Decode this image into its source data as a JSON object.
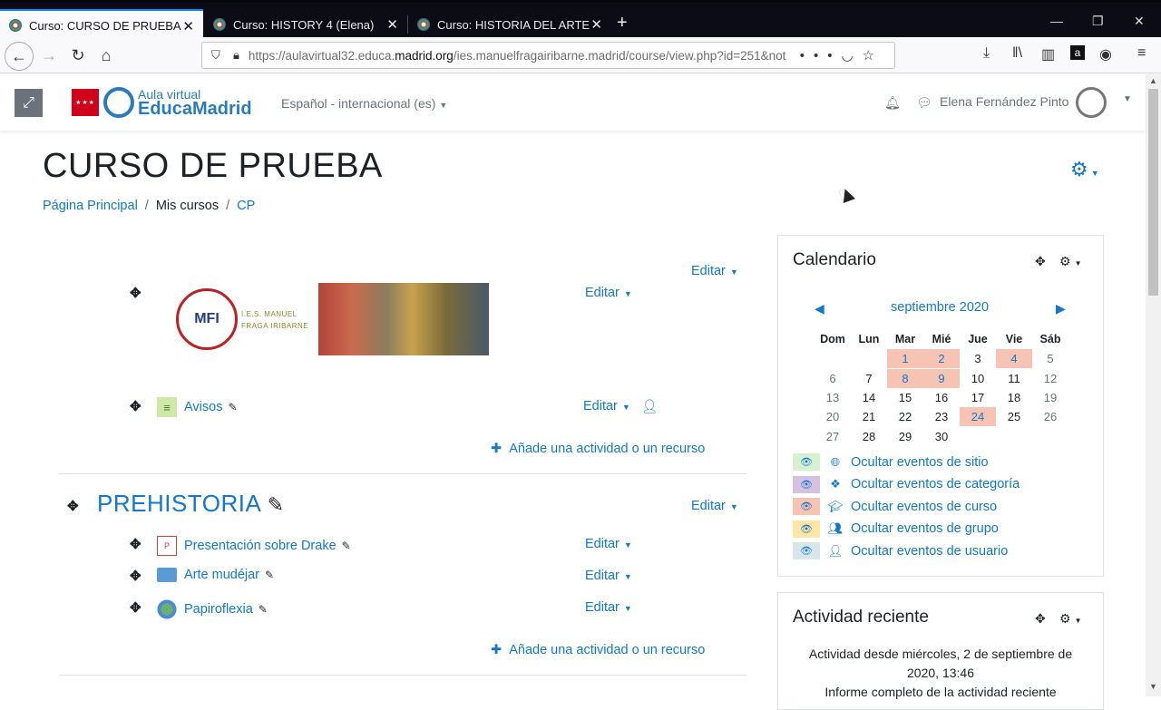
{
  "browser": {
    "tabs": [
      {
        "title": "Curso: CURSO DE PRUEBA",
        "active": true
      },
      {
        "title": "Curso: HISTORY 4 (Elena)",
        "active": false
      },
      {
        "title": "Curso: HISTORIA DEL ARTE",
        "active": false
      }
    ],
    "url_prefix": "https://aulavirtual32.educa.",
    "url_domain": "madrid.org",
    "url_suffix": "/ies.manuelfragairibarne.madrid/course/view.php?id=251&not"
  },
  "header": {
    "logo_line1": "Aula virtual",
    "logo_line2": "EducaMadrid",
    "language": "Español - internacional (es)",
    "user_name": "Elena Fernández Pinto"
  },
  "page": {
    "title": "CURSO DE PRUEBA",
    "breadcrumb": [
      "Página Principal",
      "Mis cursos",
      "CP"
    ]
  },
  "course": {
    "edit_label": "Editar",
    "add_label": "Añade una actividad o un recurso",
    "top_activities": [
      {
        "name": "Avisos",
        "icon": "forum-icon"
      }
    ],
    "section_title": "PREHISTORIA",
    "section_activities": [
      {
        "name": "Presentación sobre Drake",
        "icon": "powerpoint-icon"
      },
      {
        "name": "Arte mudéjar",
        "icon": "folder-icon"
      },
      {
        "name": "Papiroflexia",
        "icon": "url-icon"
      }
    ],
    "logo_text": "MFI",
    "logo_school": "I.E.S. MANUEL FRAGA IRIBARNE"
  },
  "calendar": {
    "title": "Calendario",
    "month": "septiembre 2020",
    "days": [
      "Dom",
      "Lun",
      "Mar",
      "Mié",
      "Jue",
      "Vie",
      "Sáb"
    ],
    "weeks": [
      [
        "",
        "",
        "1",
        "2",
        "3",
        "4",
        "5"
      ],
      [
        "6",
        "7",
        "8",
        "9",
        "10",
        "11",
        "12"
      ],
      [
        "13",
        "14",
        "15",
        "16",
        "17",
        "18",
        "19"
      ],
      [
        "20",
        "21",
        "22",
        "23",
        "24",
        "25",
        "26"
      ],
      [
        "27",
        "28",
        "29",
        "30",
        "",
        "",
        ""
      ]
    ],
    "event_days": [
      "1",
      "2",
      "4",
      "8",
      "9",
      "24"
    ],
    "filters": [
      {
        "label": "Ocultar eventos de sitio",
        "color": "#d7f0d0",
        "icon": "globe-icon"
      },
      {
        "label": "Ocultar eventos de categoría",
        "color": "#d6c2e0",
        "icon": "cubes-icon"
      },
      {
        "label": "Ocultar eventos de curso",
        "color": "#f7c4b3",
        "icon": "graduation-cap-icon"
      },
      {
        "label": "Ocultar eventos de grupo",
        "color": "#fde6a6",
        "icon": "users-icon"
      },
      {
        "label": "Ocultar eventos de usuario",
        "color": "#d8e6ea",
        "icon": "user-icon"
      }
    ]
  },
  "recent": {
    "title": "Actividad reciente",
    "since": "Actividad desde miércoles, 2 de septiembre de 2020, 13:46",
    "report": "Informe completo de la actividad reciente"
  },
  "colors": {
    "link": "#1177d1",
    "tabbar": "#0c0c17"
  }
}
